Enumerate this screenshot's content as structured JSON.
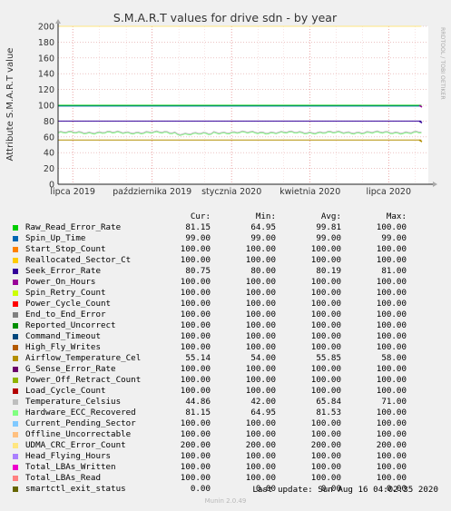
{
  "chart_data": {
    "type": "line",
    "title": "S.M.A.R.T values for drive sdn - by year",
    "ylabel": "Attribute S.M.A.R.T value",
    "side_label": "RRDTOOL / TOBI OETIKER",
    "ylim": [
      0,
      200
    ],
    "yticks": [
      "0",
      "20",
      "40",
      "60",
      "80",
      "100",
      "120",
      "140",
      "160",
      "180",
      "200"
    ],
    "xlim": [
      "2019-06-14",
      "2020-08-16"
    ],
    "xticks": [
      {
        "label": "lipca 2019",
        "date": "2019-07-01"
      },
      {
        "label": "października 2019",
        "date": "2019-10-01"
      },
      {
        "label": "stycznia 2020",
        "date": "2020-01-01"
      },
      {
        "label": "kwietnia 2020",
        "date": "2020-04-01"
      },
      {
        "label": "lipca 2020",
        "date": "2020-07-01"
      }
    ],
    "grid": true,
    "legend_header": [
      "Cur:",
      "Min:",
      "Avg:",
      "Max:"
    ],
    "series": [
      {
        "name": "Raw_Read_Error_Rate",
        "color": "#00cc00",
        "cur": "81.15",
        "min": "64.95",
        "avg": "99.81",
        "max": "100.00",
        "level": 100
      },
      {
        "name": "Spin_Up_Time",
        "color": "#0066b3",
        "cur": "99.00",
        "min": "99.00",
        "avg": "99.00",
        "max": "99.00",
        "level": 99
      },
      {
        "name": "Start_Stop_Count",
        "color": "#ff8000",
        "cur": "100.00",
        "min": "100.00",
        "avg": "100.00",
        "max": "100.00",
        "level": 100
      },
      {
        "name": "Reallocated_Sector_Ct",
        "color": "#ffcc00",
        "cur": "100.00",
        "min": "100.00",
        "avg": "100.00",
        "max": "100.00",
        "level": 100
      },
      {
        "name": "Seek_Error_Rate",
        "color": "#330099",
        "cur": "80.75",
        "min": "80.00",
        "avg": "80.19",
        "max": "81.00",
        "level": 80
      },
      {
        "name": "Power_On_Hours",
        "color": "#990099",
        "cur": "100.00",
        "min": "100.00",
        "avg": "100.00",
        "max": "100.00",
        "level": 100
      },
      {
        "name": "Spin_Retry_Count",
        "color": "#ccff00",
        "cur": "100.00",
        "min": "100.00",
        "avg": "100.00",
        "max": "100.00",
        "level": 100
      },
      {
        "name": "Power_Cycle_Count",
        "color": "#ff0000",
        "cur": "100.00",
        "min": "100.00",
        "avg": "100.00",
        "max": "100.00",
        "level": 100
      },
      {
        "name": "End_to_End_Error",
        "color": "#808080",
        "cur": "100.00",
        "min": "100.00",
        "avg": "100.00",
        "max": "100.00",
        "level": 100
      },
      {
        "name": "Reported_Uncorrect",
        "color": "#008f00",
        "cur": "100.00",
        "min": "100.00",
        "avg": "100.00",
        "max": "100.00",
        "level": 100
      },
      {
        "name": "Command_Timeout",
        "color": "#00487d",
        "cur": "100.00",
        "min": "100.00",
        "avg": "100.00",
        "max": "100.00",
        "level": 100
      },
      {
        "name": "High_Fly_Writes",
        "color": "#b35a00",
        "cur": "100.00",
        "min": "100.00",
        "avg": "100.00",
        "max": "100.00",
        "level": 100
      },
      {
        "name": "Airflow_Temperature_Cel",
        "color": "#b38f00",
        "cur": "55.14",
        "min": "54.00",
        "avg": "55.85",
        "max": "58.00",
        "level": 56
      },
      {
        "name": "G_Sense_Error_Rate",
        "color": "#6b006b",
        "cur": "100.00",
        "min": "100.00",
        "avg": "100.00",
        "max": "100.00",
        "level": 100
      },
      {
        "name": "Power_Off_Retract_Count",
        "color": "#8fb300",
        "cur": "100.00",
        "min": "100.00",
        "avg": "100.00",
        "max": "100.00",
        "level": 100
      },
      {
        "name": "Load_Cycle_Count",
        "color": "#b30000",
        "cur": "100.00",
        "min": "100.00",
        "avg": "100.00",
        "max": "100.00",
        "level": 100
      },
      {
        "name": "Temperature_Celsius",
        "color": "#bebebe",
        "cur": "44.86",
        "min": "42.00",
        "avg": "65.84",
        "max": "71.00",
        "level": 66
      },
      {
        "name": "Hardware_ECC_Recovered",
        "color": "#80ff80",
        "cur": "81.15",
        "min": "64.95",
        "avg": "81.53",
        "max": "100.00",
        "level": 65
      },
      {
        "name": "Current_Pending_Sector",
        "color": "#80c9ff",
        "cur": "100.00",
        "min": "100.00",
        "avg": "100.00",
        "max": "100.00",
        "level": 100
      },
      {
        "name": "Offline_Uncorrectable",
        "color": "#ffc080",
        "cur": "100.00",
        "min": "100.00",
        "avg": "100.00",
        "max": "100.00",
        "level": 100
      },
      {
        "name": "UDMA_CRC_Error_Count",
        "color": "#ffe680",
        "cur": "200.00",
        "min": "200.00",
        "avg": "200.00",
        "max": "200.00",
        "level": 200
      },
      {
        "name": "Head_Flying_Hours",
        "color": "#aa80ff",
        "cur": "100.00",
        "min": "100.00",
        "avg": "100.00",
        "max": "100.00",
        "level": 100
      },
      {
        "name": "Total_LBAs_Written",
        "color": "#ee00cc",
        "cur": "100.00",
        "min": "100.00",
        "avg": "100.00",
        "max": "100.00",
        "level": 100
      },
      {
        "name": "Total_LBAs_Read",
        "color": "#ff8080",
        "cur": "100.00",
        "min": "100.00",
        "avg": "100.00",
        "max": "100.00",
        "level": 100
      },
      {
        "name": "smartctl_exit_status",
        "color": "#666600",
        "cur": "0.00",
        "min": "0.00",
        "avg": "0.00",
        "max": "0.00",
        "level": 0
      }
    ]
  },
  "last_update": "Last update: Sun Aug 16 04:02:35 2020",
  "footer": "Munin 2.0.49"
}
